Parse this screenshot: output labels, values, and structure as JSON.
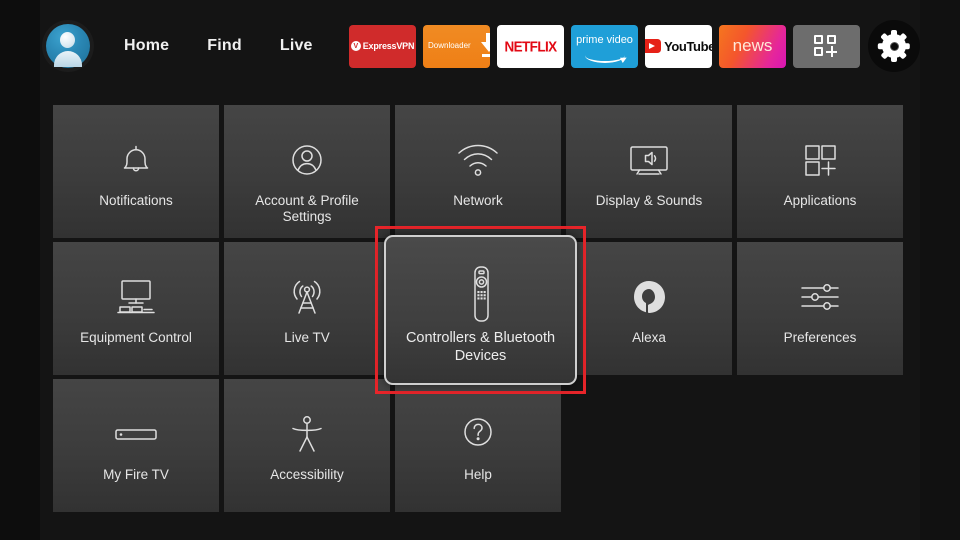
{
  "topbar": {
    "avatar_name": "profile-avatar",
    "nav": [
      {
        "label": "Home"
      },
      {
        "label": "Find"
      },
      {
        "label": "Live"
      }
    ],
    "apps": [
      {
        "name": "expressvpn",
        "label": "ExpressVPN",
        "mark": "V",
        "color": "#d02b2b"
      },
      {
        "name": "downloader",
        "label": "Downloader",
        "color": "#ef7f16"
      },
      {
        "name": "netflix",
        "label": "NETFLIX",
        "color": "#e20914"
      },
      {
        "name": "prime-video",
        "label": "prime video",
        "color": "#1f9fd8"
      },
      {
        "name": "youtube",
        "label": "YouTube",
        "color": "#e62117"
      },
      {
        "name": "news",
        "label": "news",
        "color": "#e5269b"
      },
      {
        "name": "apps-grid",
        "label": "",
        "color": "#6d6d6d"
      },
      {
        "name": "settings-gear",
        "label": "",
        "color": "#0a0a0a"
      }
    ]
  },
  "settings_grid": {
    "rows": [
      [
        {
          "label": "Notifications",
          "icon": "bell-icon"
        },
        {
          "label": "Account & Profile Settings",
          "icon": "person-circle-icon"
        },
        {
          "label": "Network",
          "icon": "wifi-icon"
        },
        {
          "label": "Display & Sounds",
          "icon": "tv-sound-icon"
        },
        {
          "label": "Applications",
          "icon": "apps-grid-icon"
        }
      ],
      [
        {
          "label": "Equipment Control",
          "icon": "tv-equipment-icon"
        },
        {
          "label": "Live TV",
          "icon": "broadcast-tower-icon"
        },
        {
          "label": "Controllers & Bluetooth Devices",
          "icon": "remote-control-icon",
          "focused": true
        },
        {
          "label": "Alexa",
          "icon": "alexa-ring-icon"
        },
        {
          "label": "Preferences",
          "icon": "sliders-icon"
        }
      ],
      [
        {
          "label": "My Fire TV",
          "icon": "fire-stick-icon"
        },
        {
          "label": "Accessibility",
          "icon": "accessibility-person-icon"
        },
        {
          "label": "Help",
          "icon": "question-circle-icon"
        }
      ]
    ],
    "focus_highlight_color": "#e8252a"
  }
}
